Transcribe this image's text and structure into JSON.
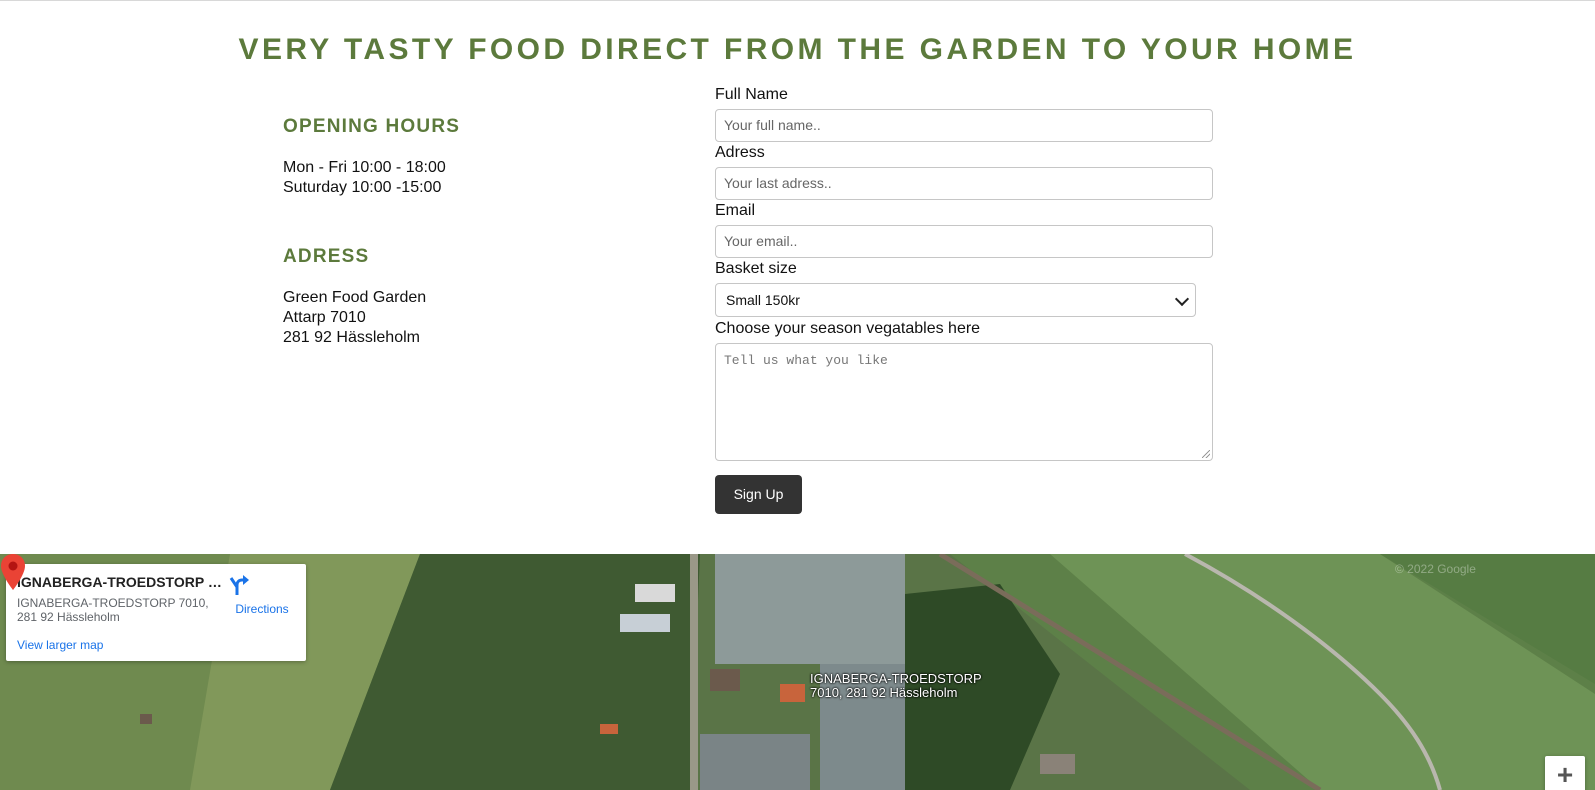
{
  "headline": "VERY TASTY FOOD DIRECT FROM THE GARDEN TO YOUR HOME",
  "info": {
    "hours_title": "OPENING HOURS",
    "hours": [
      "Mon - Fri 10:00 - 18:00",
      "Suturday 10:00 -15:00"
    ],
    "adress_title": "ADRESS",
    "adress": [
      "Green Food Garden",
      "Attarp 7010",
      "281 92 Hässleholm"
    ]
  },
  "form": {
    "full_name": {
      "label": "Full Name",
      "placeholder": "Your full name.."
    },
    "adress": {
      "label": "Adress",
      "placeholder": "Your last adress.."
    },
    "email": {
      "label": "Email",
      "placeholder": "Your email.."
    },
    "basket": {
      "label": "Basket size",
      "selected": "Small 150kr"
    },
    "season": {
      "label": "Choose your season vegatables here",
      "placeholder": "Tell us what you like"
    },
    "submit_label": "Sign Up"
  },
  "map": {
    "place_name": "IGNABERGA-TROEDSTORP 70...",
    "place_address": "IGNABERGA-TROEDSTORP 7010, 281 92 Hässleholm",
    "directions_label": "Directions",
    "larger_map_label": "View larger map",
    "marker_label_line1": "IGNABERGA-TROEDSTORP",
    "marker_label_line2": "7010, 281 92 Hässleholm",
    "watermark": "© 2022 Google",
    "zoom_in": "+",
    "colors": {
      "pin": "#ea4335",
      "link": "#1a73e8"
    }
  },
  "colors": {
    "accent": "#5c7a3c",
    "button": "#333333"
  }
}
